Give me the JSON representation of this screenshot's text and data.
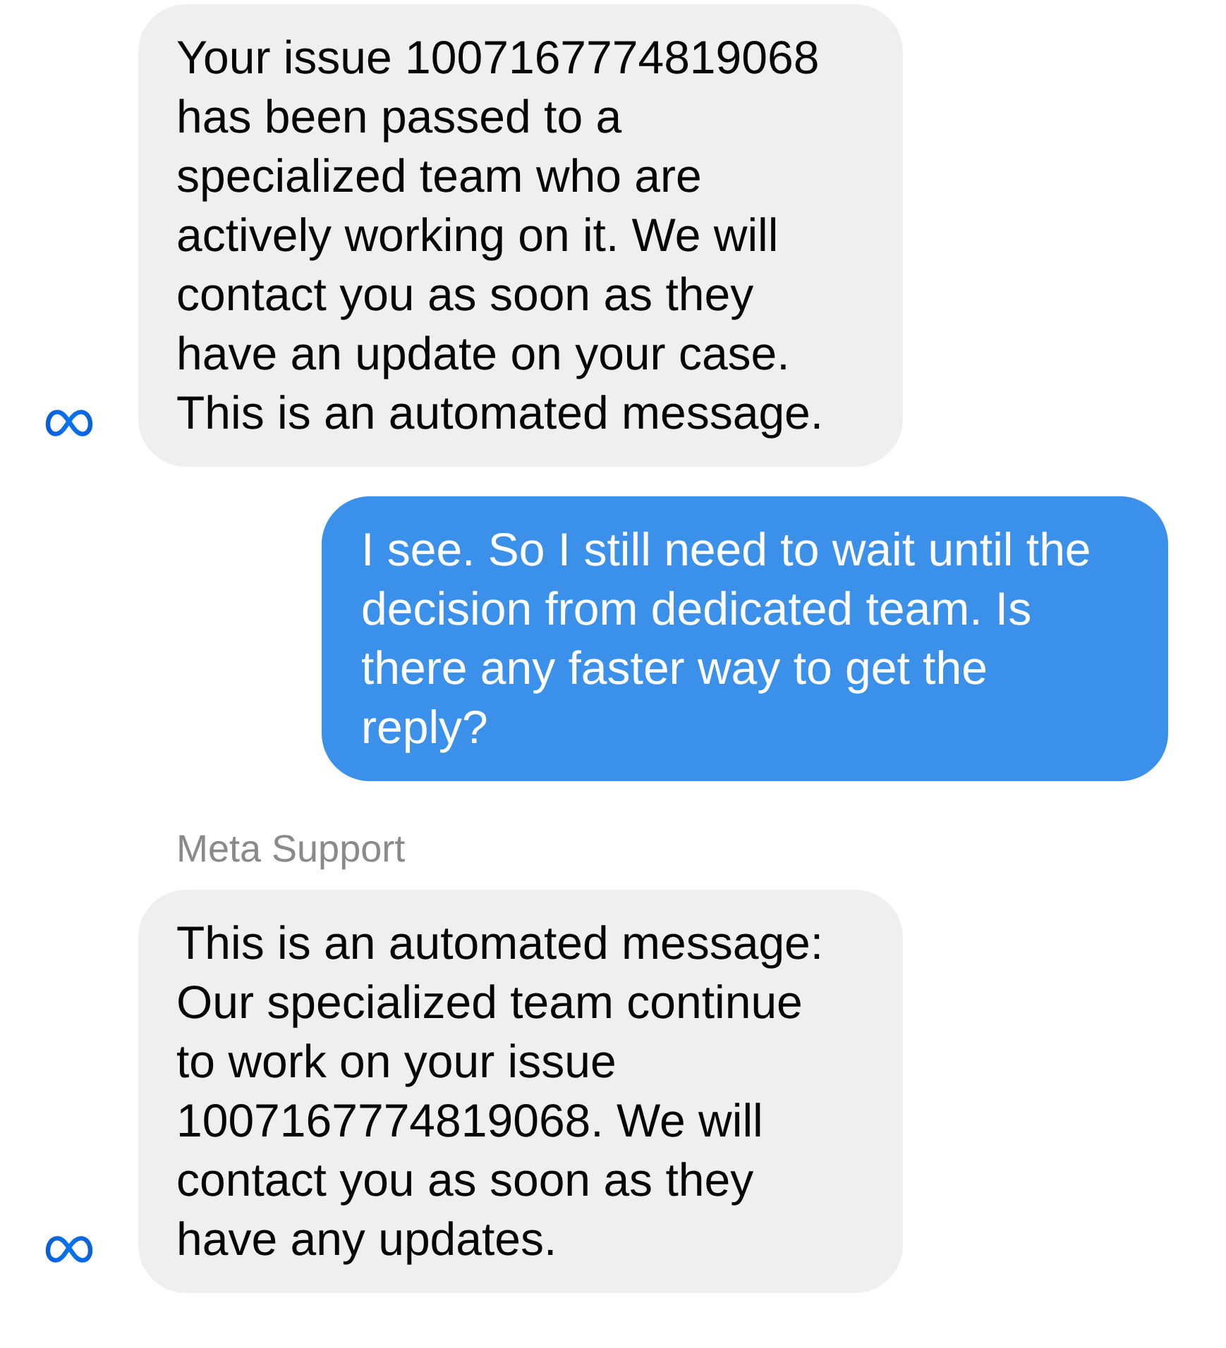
{
  "messages": [
    {
      "kind": "received",
      "text": "Your issue 1007167774819068 has been passed to a specialized team who are actively working on it. We will contact you as soon as they have an update on your case. This is an automated message."
    },
    {
      "kind": "sent",
      "text": "I see. So I still need to wait until the decision from dedicated team. Is there any faster way to get the reply?"
    },
    {
      "kind": "received",
      "sender": "Meta Support",
      "text": "This is an automated message: Our specialized team continue to work on your issue 1007167774819068. We will contact you as soon as they have any updates."
    }
  ]
}
